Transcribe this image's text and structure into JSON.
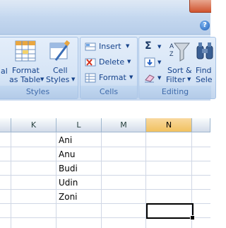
{
  "ribbon": {
    "styles": {
      "cut_label": "al",
      "format_as_table_line1": "Format",
      "format_as_table_line2": "as Table",
      "cell_styles_line1": "Cell",
      "cell_styles_line2": "Styles",
      "group_label": "Styles"
    },
    "cells": {
      "insert_label": "Insert",
      "delete_label": "Delete",
      "format_label": "Format",
      "group_label": "Cells"
    },
    "editing": {
      "sigma_symbol": "Σ",
      "sort_filter_line1": "Sort &",
      "sort_filter_line2": "Filter",
      "find_line1": "Find",
      "find_line2": "Sele",
      "group_label": "Editing"
    },
    "help_symbol": "?"
  },
  "sheet": {
    "columns": [
      "K",
      "L",
      "M",
      "N"
    ],
    "active_column": "N",
    "cells_L": [
      "Ani",
      "Anu",
      "Budi",
      "Udin",
      "Zoni"
    ]
  },
  "icons": {
    "help": "help-icon",
    "close": "close-icon",
    "format_as_table": "format-as-table-icon",
    "cell_styles": "cell-styles-icon",
    "insert": "insert-cells-icon",
    "delete": "delete-cells-icon",
    "format": "format-cells-icon",
    "autosum": "sigma-icon",
    "fill": "fill-icon",
    "clear": "eraser-icon",
    "sort_filter": "funnel-icon",
    "find": "binoculars-icon"
  }
}
